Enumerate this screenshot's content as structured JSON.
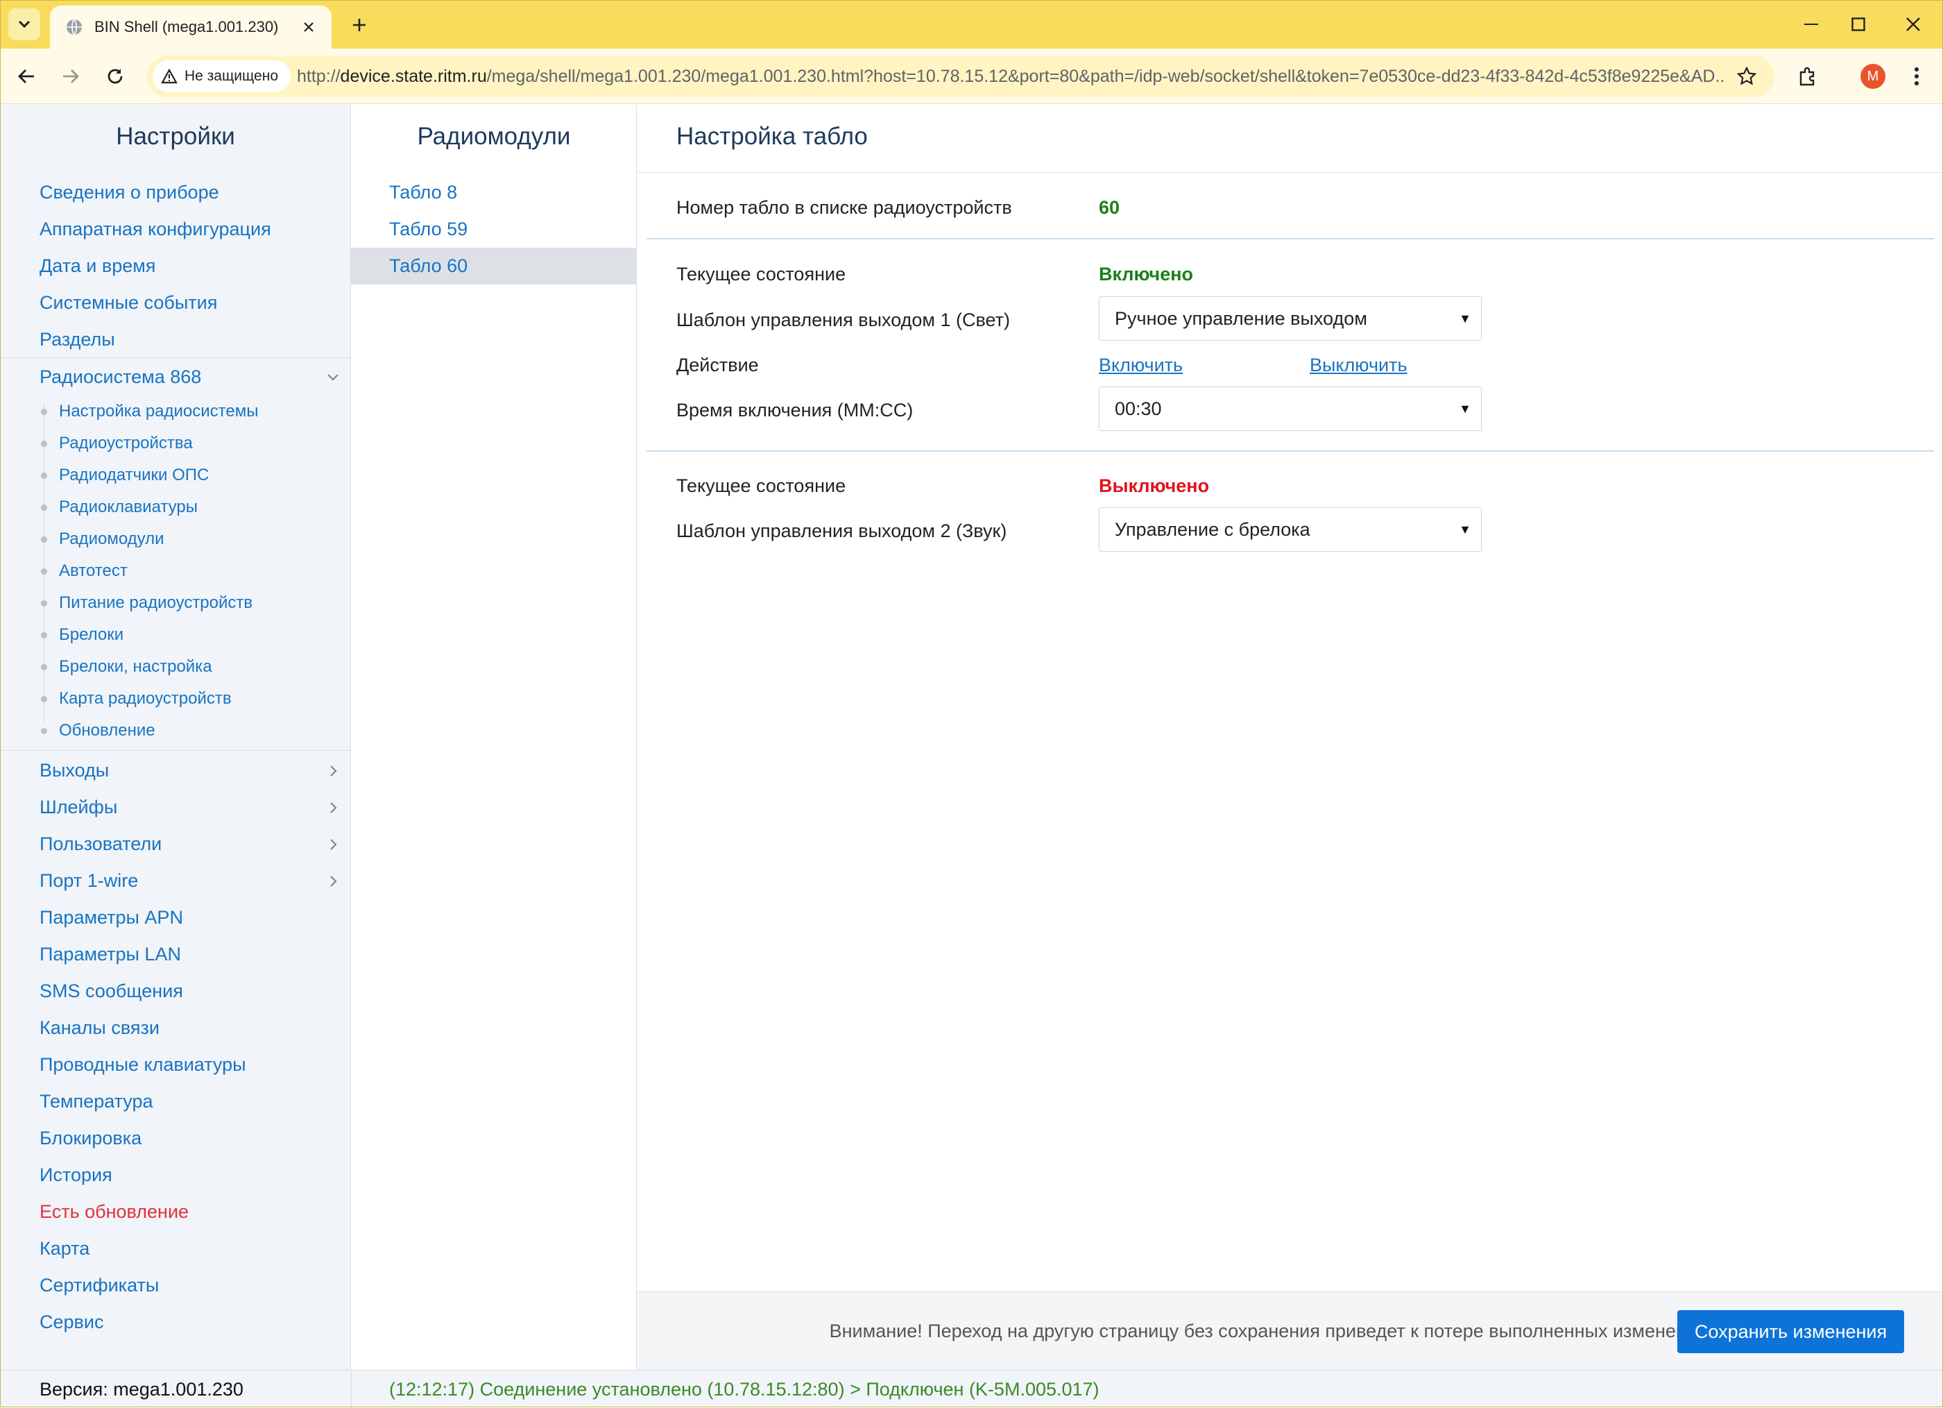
{
  "browser": {
    "tab_title": "BIN Shell (mega1.001.230)",
    "security_label": "Не защищено",
    "url_prefix": "http://",
    "url_host": "device.state.ritm.ru",
    "url_rest": "/mega/shell/mega1.001.230/mega1.001.230.html?host=10.78.15.12&port=80&path=/idp-web/socket/shell&token=7e0530ce-dd23-4f33-842d-4c53f8e9225e&AD...",
    "profile_initial": "M",
    "theme_color": "#f9dc5c"
  },
  "sidebar": {
    "title": "Настройки",
    "items_top": [
      "Сведения о приборе",
      "Аппаратная конфигурация",
      "Дата и время",
      "Системные события",
      "Разделы"
    ],
    "group": {
      "label": "Радиосистема 868",
      "subitems": [
        "Настройка радиосистемы",
        "Радиоустройства",
        "Радиодатчики ОПС",
        "Радиоклавиатуры",
        "Радиомодули",
        "Автотест",
        "Питание радиоустройств",
        "Брелоки",
        "Брелоки, настройка",
        "Карта радиоустройств",
        "Обновление"
      ]
    },
    "items_expandable": [
      "Выходы",
      "Шлейфы",
      "Пользователи",
      "Порт 1-wire"
    ],
    "items_bottom": [
      "Параметры APN",
      "Параметры LAN",
      "SMS сообщения",
      "Каналы связи",
      "Проводные клавиатуры",
      "Температура",
      "Блокировка",
      "История"
    ],
    "update_item": "Есть обновление",
    "items_end": [
      "Карта",
      "Сертификаты",
      "Сервис"
    ]
  },
  "middle": {
    "title": "Радиомодули",
    "items": [
      "Табло 8",
      "Табло 59",
      "Табло 60"
    ],
    "active_index": 2
  },
  "content": {
    "title": "Настройка табло",
    "number_label": "Номер табло в списке радиоустройств",
    "number_value": "60",
    "output1": {
      "state_label": "Текущее состояние",
      "state_value": "Включено",
      "state_color": "#1a7f1a",
      "template_label": "Шаблон управления выходом 1 (Свет)",
      "template_value": "Ручное управление выходом",
      "action_label": "Действие",
      "action_on": "Включить",
      "action_off": "Выключить",
      "time_label": "Время включения (ММ:СС)",
      "time_value": "00:30"
    },
    "output2": {
      "state_label": "Текущее состояние",
      "state_value": "Выключено",
      "state_color": "#e0131f",
      "template_label": "Шаблон управления выходом 2 (Звук)",
      "template_value": "Управление с брелока"
    },
    "footer_warning": "Внимание! Переход на другую страницу без сохранения приведет к потере выполненных изменений",
    "save_label": "Сохранить изменения"
  },
  "status": {
    "version": "Версия: mega1.001.230",
    "connection": "(12:12:17) Соединение установлено (10.78.15.12:80) > Подключен (K-5M.005.017)"
  }
}
